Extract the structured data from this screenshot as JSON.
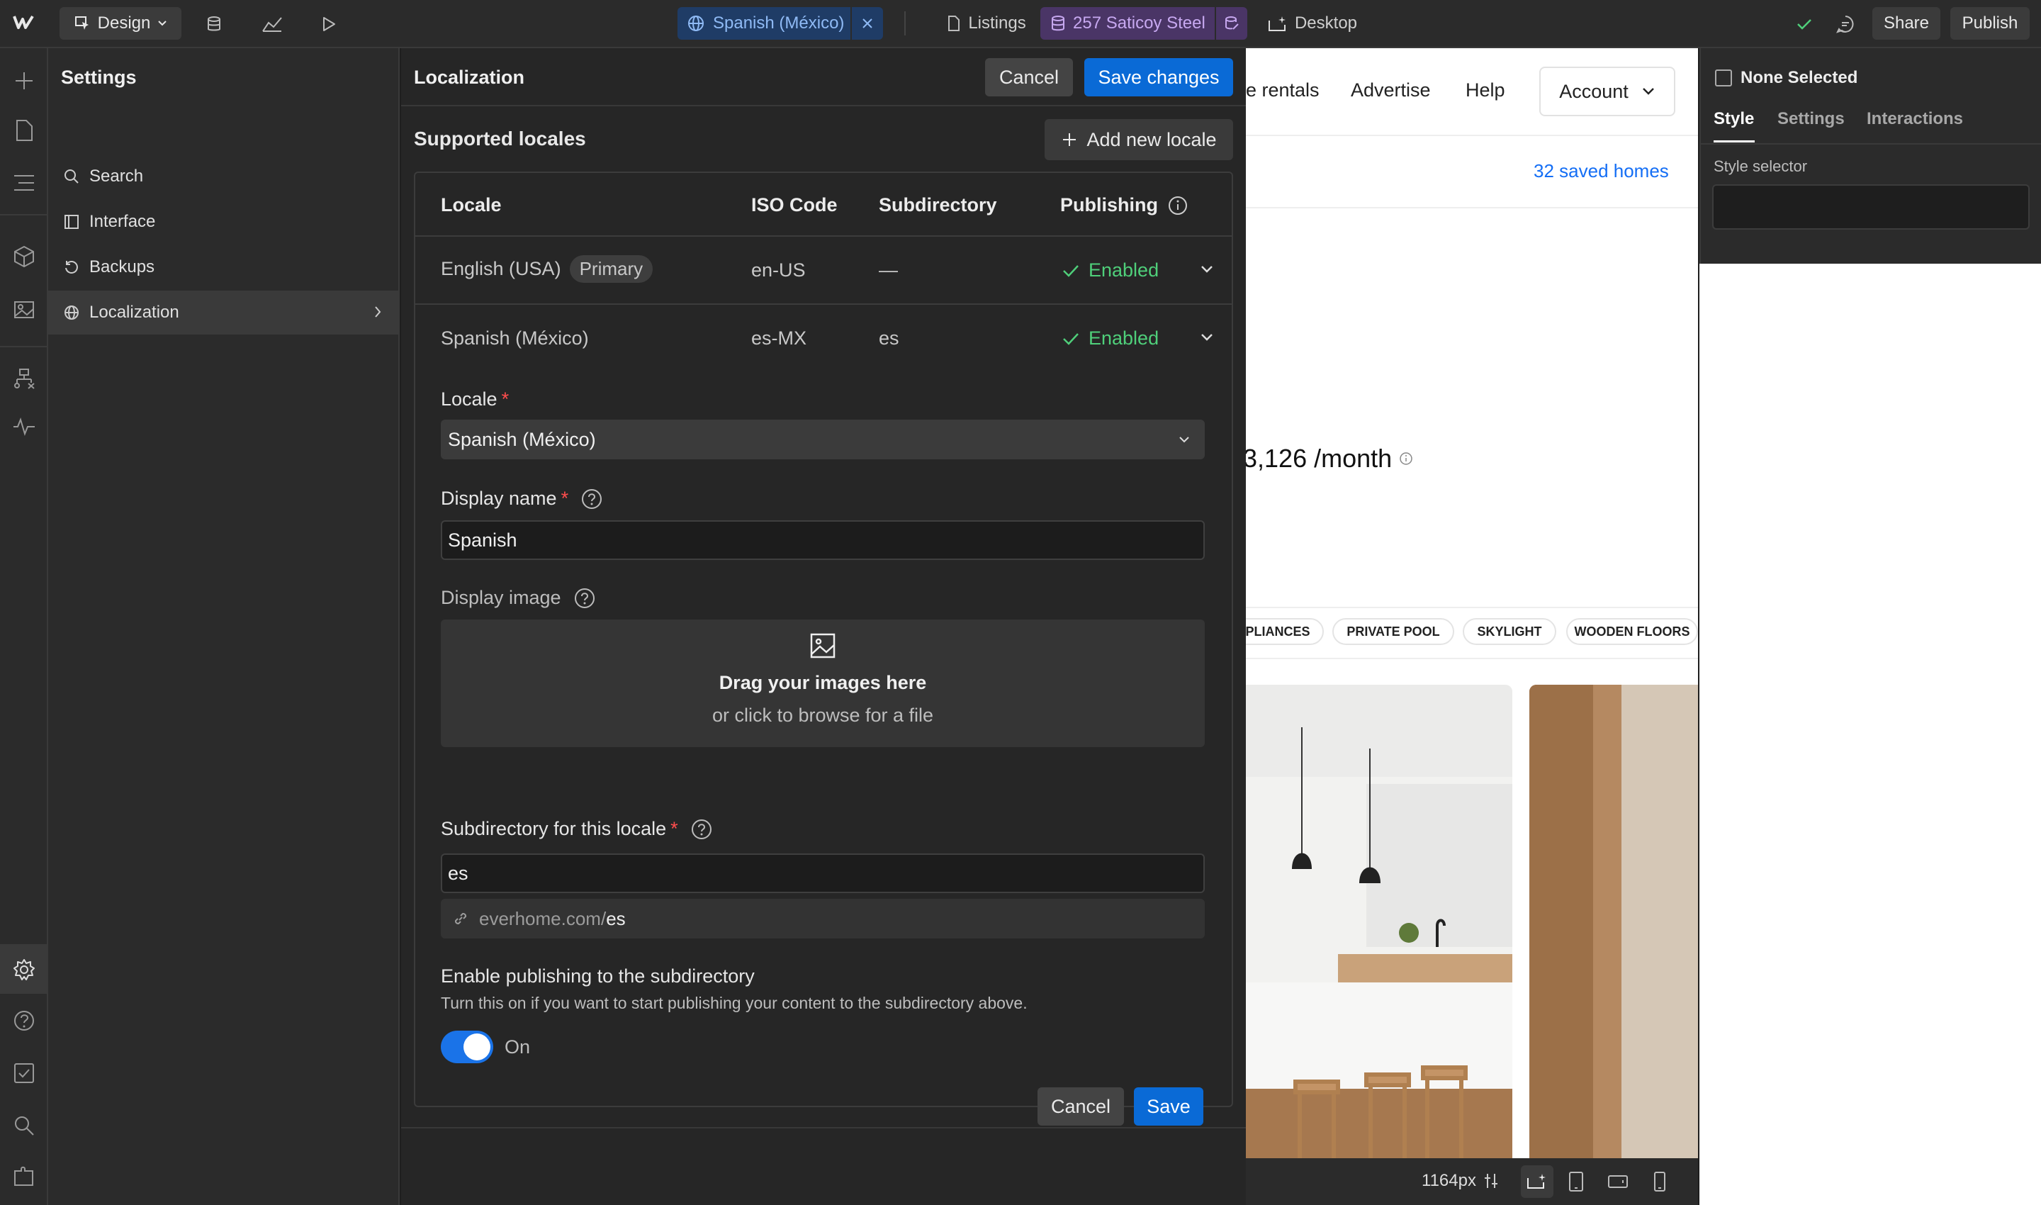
{
  "topbar": {
    "mode_label": "Design",
    "locale_label": "Spanish (México)",
    "page_label": "Listings",
    "cms_label": "257 Saticoy Steel",
    "breakpoint_label": "Desktop",
    "share_label": "Share",
    "publish_label": "Publish"
  },
  "settings": {
    "title": "Settings",
    "items": [
      {
        "label": "Search",
        "icon": "search-icon"
      },
      {
        "label": "Interface",
        "icon": "layout-icon"
      },
      {
        "label": "Backups",
        "icon": "history-icon"
      },
      {
        "label": "Localization",
        "icon": "globe-icon",
        "active": true
      }
    ]
  },
  "localization": {
    "title": "Localization",
    "cancel_label": "Cancel",
    "save_changes_label": "Save changes",
    "supported_title": "Supported locales",
    "add_locale_label": "Add new locale",
    "columns": [
      "Locale",
      "ISO Code",
      "Subdirectory",
      "Publishing"
    ],
    "rows": [
      {
        "locale": "English (USA)",
        "badge": "Primary",
        "iso": "en-US",
        "subdir": "—",
        "publishing": "Enabled"
      },
      {
        "locale": "Spanish (México)",
        "iso": "es-MX",
        "subdir": "es",
        "publishing": "Enabled"
      }
    ],
    "form": {
      "locale_label": "Locale",
      "locale_value": "Spanish (México)",
      "display_name_label": "Display name",
      "display_name_value": "Spanish",
      "display_image_label": "Display image",
      "drop_title": "Drag your images here",
      "drop_sub": "or click to browse for a file",
      "subdir_label": "Subdirectory for this locale",
      "subdir_value": "es",
      "url_prefix": "everhome.com/",
      "url_suffix": "es",
      "publish_title": "Enable publishing to the subdirectory",
      "publish_desc": "Turn this on if you want to start publishing your content to the subdirectory above.",
      "toggle_label": "On",
      "toggle_on": true,
      "cancel_label": "Cancel",
      "save_label": "Save"
    }
  },
  "canvas": {
    "nav": [
      "e rentals",
      "Advertise",
      "Help"
    ],
    "account_label": "Account",
    "saved_homes": "32 saved homes",
    "price": "3,126 /month",
    "tags": [
      "PLIANCES",
      "PRIVATE POOL",
      "SKYLIGHT",
      "WOODEN FLOORS"
    ],
    "width_readout": "1164px"
  },
  "right_panel": {
    "selection": "None Selected",
    "tabs": [
      "Style",
      "Settings",
      "Interactions"
    ],
    "style_selector_label": "Style selector"
  },
  "colors": {
    "accent_blue": "#0a6ad6",
    "enabled_green": "#4fcf7a",
    "link_blue": "#146ef5"
  }
}
